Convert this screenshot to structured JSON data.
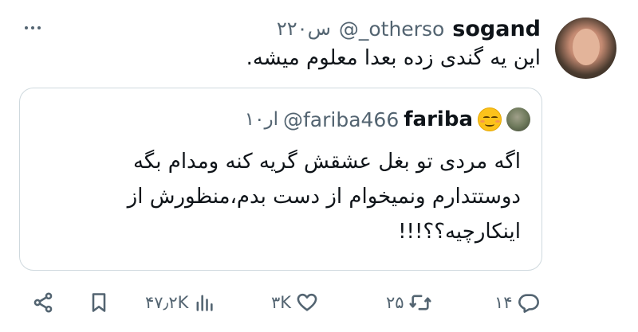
{
  "tweet": {
    "author_name": "sogand",
    "author_handle": "@_otherso",
    "time": "۲۲۰س",
    "text": "این یه گندی زده بعدا معلوم میشه."
  },
  "quote": {
    "author_name": "fariba",
    "author_handle": "@fariba466",
    "time": "۱۰ار",
    "lines": [
      "اگه مردی تو بغل عشقش گریه کنه ومدام بگه",
      "دوستتدارم ونمیخوام از دست بدم،منظورش از",
      "اینکارچیه؟؟!!!"
    ]
  },
  "actions": {
    "replies": "۱۴",
    "retweets": "۲۵",
    "likes": "۳K",
    "views": "۴۷٫۲K"
  },
  "icons": {
    "more": "more-horizontal-icon",
    "reply": "reply-icon",
    "retweet": "retweet-icon",
    "like": "heart-icon",
    "views": "analytics-icon",
    "bookmark": "bookmark-icon",
    "share": "share-icon"
  },
  "colors": {
    "text": "#0f1419",
    "secondary": "#536471",
    "border": "#cfd9de"
  }
}
